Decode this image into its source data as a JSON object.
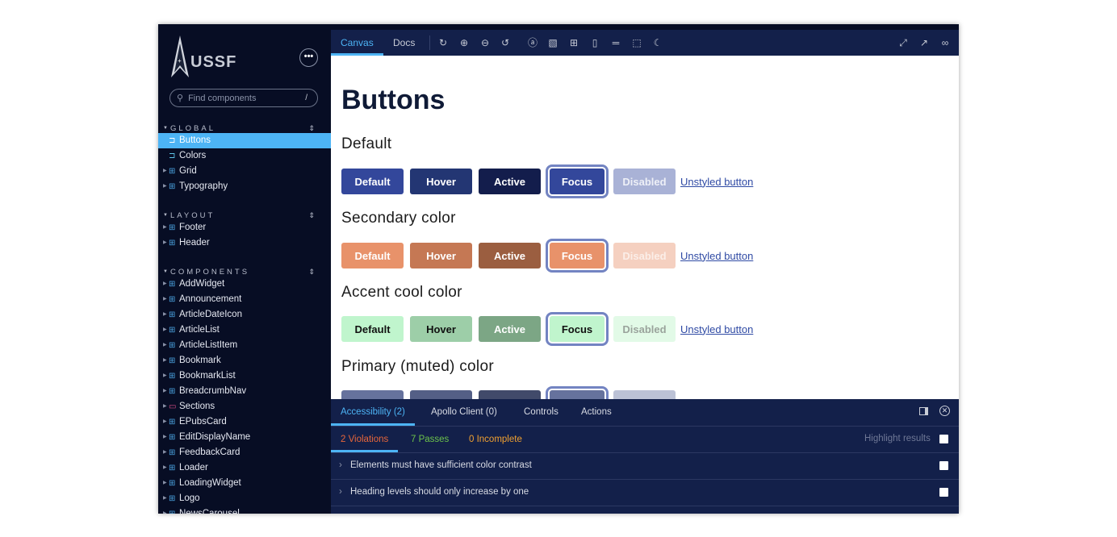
{
  "sidebar": {
    "logo": "USSF",
    "more_label": "•••",
    "search": {
      "placeholder": "Find components",
      "shortcut": "/"
    },
    "groups": [
      {
        "label": "GLOBAL",
        "items": [
          {
            "label": "Buttons",
            "icon": "bookmark-icon",
            "selected": true
          },
          {
            "label": "Colors",
            "icon": "bookmark-icon"
          },
          {
            "label": "Grid",
            "icon": "component-icon"
          },
          {
            "label": "Typography",
            "icon": "component-icon"
          }
        ]
      },
      {
        "label": "LAYOUT",
        "items": [
          {
            "label": "Footer",
            "icon": "component-icon"
          },
          {
            "label": "Header",
            "icon": "component-icon"
          }
        ]
      },
      {
        "label": "COMPONENTS",
        "items": [
          {
            "label": "AddWidget"
          },
          {
            "label": "Announcement"
          },
          {
            "label": "ArticleDateIcon"
          },
          {
            "label": "ArticleList"
          },
          {
            "label": "ArticleListItem"
          },
          {
            "label": "Bookmark"
          },
          {
            "label": "BookmarkList"
          },
          {
            "label": "BreadcrumbNav"
          },
          {
            "label": "Sections",
            "icon": "folder-icon"
          },
          {
            "label": "EPubsCard"
          },
          {
            "label": "EditDisplayName"
          },
          {
            "label": "FeedbackCard"
          },
          {
            "label": "Loader"
          },
          {
            "label": "LoadingWidget"
          },
          {
            "label": "Logo"
          },
          {
            "label": "NewsCarousel"
          }
        ]
      }
    ]
  },
  "toolbar": {
    "tabs": [
      "Canvas",
      "Docs"
    ],
    "active_tab": "Canvas",
    "icons": [
      "refresh-icon",
      "zoom-in-icon",
      "zoom-out-icon",
      "zoom-reset-icon",
      "accessibility-icon",
      "background-icon",
      "grid-icon",
      "viewport-icon",
      "measure-icon",
      "outline-icon",
      "dark-mode-icon"
    ],
    "right_icons": [
      "fullscreen-icon",
      "open-new-tab-icon",
      "copy-link-icon"
    ]
  },
  "canvas": {
    "title": "Buttons",
    "sections": [
      {
        "heading": "Default",
        "buttons": [
          "Default",
          "Hover",
          "Active",
          "Focus",
          "Disabled"
        ],
        "colors": [
          "#33479b",
          "#233673",
          "#131d4c",
          "#33479b",
          "#a9b2d6"
        ],
        "text_colors": [
          "#fff",
          "#fff",
          "#fff",
          "#fff",
          "#eef0f7"
        ]
      },
      {
        "heading": "Secondary color",
        "buttons": [
          "Default",
          "Hover",
          "Active",
          "Focus",
          "Disabled"
        ],
        "colors": [
          "#e8926a",
          "#c57854",
          "#9b5e40",
          "#e8926a",
          "#f5d0c0"
        ],
        "text_colors": [
          "#fff",
          "#fff",
          "#fff",
          "#fff",
          "#fbeee8"
        ]
      },
      {
        "heading": "Accent cool color",
        "buttons": [
          "Default",
          "Hover",
          "Active",
          "Focus",
          "Disabled"
        ],
        "colors": [
          "#c0f5cd",
          "#9dcea8",
          "#7ca685",
          "#c0f5cd",
          "#e2fae7"
        ],
        "text_colors": [
          "#111",
          "#111",
          "#fff",
          "#111",
          "#9aa39c"
        ]
      },
      {
        "heading": "Primary (muted) color",
        "buttons": [
          "",
          "",
          "",
          "",
          ""
        ],
        "colors": [
          "#66729d",
          "#545f86",
          "#414a6a",
          "#66729d",
          "#bcc2d6"
        ],
        "text_colors": [
          "#fff",
          "#fff",
          "#fff",
          "#fff",
          "#fff"
        ]
      }
    ],
    "link_label": "Unstyled button",
    "focus_ring_color": "#7384c2"
  },
  "panel": {
    "tabs": [
      "Accessibility (2)",
      "Apollo Client (0)",
      "Controls",
      "Actions"
    ],
    "subtabs": [
      {
        "label": "2 Violations",
        "color": "#e8663a"
      },
      {
        "label": "7 Passes",
        "color": "#6cc24a"
      },
      {
        "label": "0 Incomplete",
        "color": "#f0a030"
      }
    ],
    "highlight_label": "Highlight results",
    "rules": [
      "Elements must have sufficient color contrast",
      "Heading levels should only increase by one"
    ]
  }
}
